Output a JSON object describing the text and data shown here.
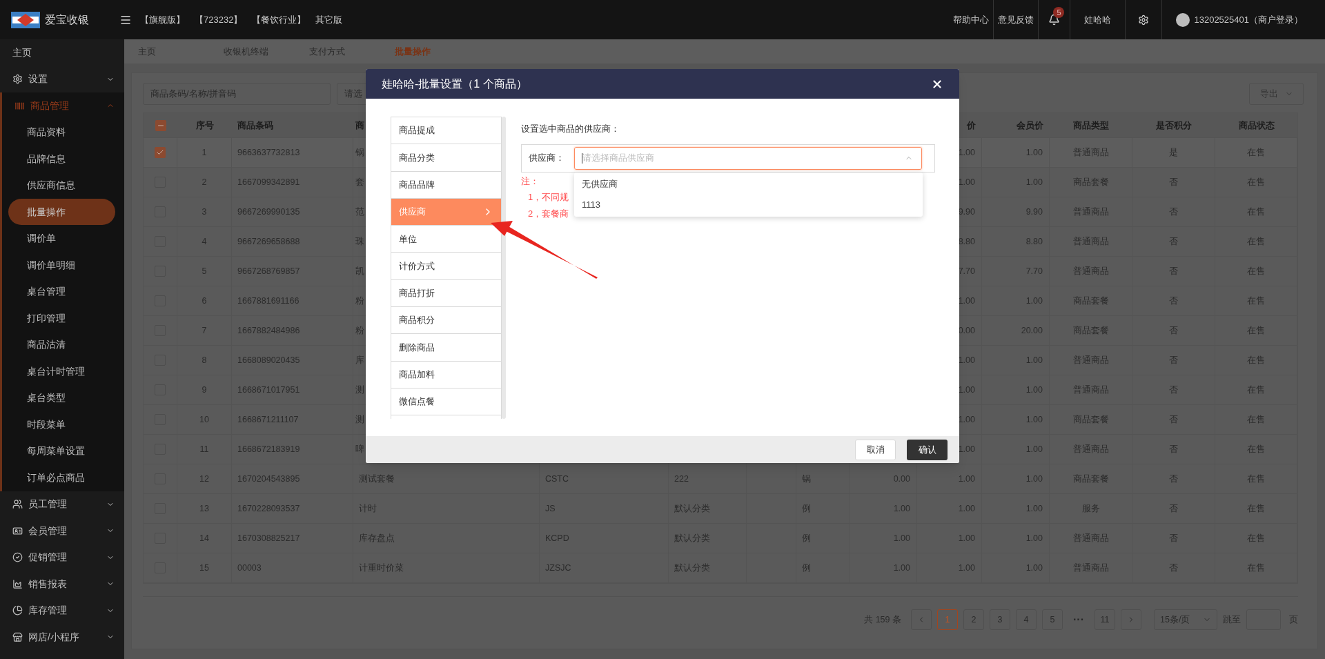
{
  "top_bar": {
    "brand": "爱宝收银",
    "editions": [
      "【旗舰版】",
      "【723232】",
      "【餐饮行业】",
      "其它版"
    ],
    "links": [
      "帮助中心",
      "意见反馈"
    ],
    "notification_count": "5",
    "user": "娃哈哈",
    "account": "13202525401（商户登录）"
  },
  "sidebar": {
    "items": [
      {
        "label": "主页",
        "selected": false
      },
      {
        "label": "设置",
        "selected": false,
        "expanded": false
      },
      {
        "label": "商品管理",
        "selected": false,
        "expanded": true,
        "children": [
          {
            "label": "商品资料",
            "selected": false
          },
          {
            "label": "品牌信息",
            "selected": false
          },
          {
            "label": "供应商信息",
            "selected": false
          },
          {
            "label": "批量操作",
            "selected": true
          },
          {
            "label": "调价单",
            "selected": false
          },
          {
            "label": "调价单明细",
            "selected": false
          },
          {
            "label": "桌台管理",
            "selected": false
          },
          {
            "label": "打印管理",
            "selected": false
          },
          {
            "label": "商品沽清",
            "selected": false
          },
          {
            "label": "桌台计时管理",
            "selected": false
          },
          {
            "label": "桌台类型",
            "selected": false
          },
          {
            "label": "时段菜单",
            "selected": false
          },
          {
            "label": "每周菜单设置",
            "selected": false
          },
          {
            "label": "订单必点商品",
            "selected": false
          }
        ]
      },
      {
        "label": "员工管理",
        "selected": false,
        "expanded": false
      },
      {
        "label": "会员管理",
        "selected": false,
        "expanded": false
      },
      {
        "label": "促销管理",
        "selected": false,
        "expanded": false
      },
      {
        "label": "销售报表",
        "selected": false,
        "expanded": false
      },
      {
        "label": "库存管理",
        "selected": false,
        "expanded": false
      },
      {
        "label": "网店/小程序",
        "selected": false,
        "expanded": false
      }
    ]
  },
  "tabs": [
    {
      "label": "主页",
      "selected": false
    },
    {
      "label": "收银机终端",
      "selected": false
    },
    {
      "label": "支付方式",
      "selected": false
    },
    {
      "label": "批量操作",
      "selected": true
    }
  ],
  "filters": {
    "search": {
      "placeholder": "商品条码/名称/拼音码"
    },
    "select": {
      "placeholder": "请选"
    },
    "export_button": "导出"
  },
  "table": {
    "select_all": {
      "indeterminate": true
    },
    "header": {
      "no": "序号",
      "barcode": "商品条码",
      "column_4": "商",
      "column_10": "价",
      "member_price": "会员价",
      "type": "商品类型",
      "points": "是否积分",
      "status": "商品状态"
    },
    "rows": [
      {
        "selected": true,
        "no": "1",
        "barcode": "9663637732813",
        "column_4": "锅",
        "column_10": "1.00",
        "member_price": "1.00",
        "type": "普通商品",
        "points": "是",
        "status": "在售"
      },
      {
        "selected": false,
        "no": "2",
        "barcode": "1667099342891",
        "column_4": "套",
        "column_10": "1.00",
        "member_price": "1.00",
        "type": "商品套餐",
        "points": "否",
        "status": "在售"
      },
      {
        "selected": false,
        "no": "3",
        "barcode": "9667269990135",
        "column_4": "范",
        "column_10": "9.90",
        "member_price": "9.90",
        "type": "普通商品",
        "points": "否",
        "status": "在售"
      },
      {
        "selected": false,
        "no": "4",
        "barcode": "9667269658688",
        "column_4": "珠",
        "column_10": "8.80",
        "member_price": "8.80",
        "type": "普通商品",
        "points": "否",
        "status": "在售"
      },
      {
        "selected": false,
        "no": "5",
        "barcode": "9667268769857",
        "column_4": "凯",
        "column_10": "7.70",
        "member_price": "7.70",
        "type": "普通商品",
        "points": "否",
        "status": "在售"
      },
      {
        "selected": false,
        "no": "6",
        "barcode": "1667881691166",
        "column_4": "粉",
        "column_10": "1.00",
        "member_price": "1.00",
        "type": "商品套餐",
        "points": "否",
        "status": "在售"
      },
      {
        "selected": false,
        "no": "7",
        "barcode": "1667882484986",
        "column_4": "粉",
        "column_10": "0.00",
        "member_price": "20.00",
        "type": "商品套餐",
        "points": "否",
        "status": "在售"
      },
      {
        "selected": false,
        "no": "8",
        "barcode": "1668089020435",
        "column_4": "库",
        "column_10": "1.00",
        "member_price": "1.00",
        "type": "普通商品",
        "points": "否",
        "status": "在售"
      },
      {
        "selected": false,
        "no": "9",
        "barcode": "1668671017951",
        "column_4": "测",
        "column_10": "1.00",
        "member_price": "1.00",
        "type": "普通商品",
        "points": "否",
        "status": "在售"
      },
      {
        "selected": false,
        "no": "10",
        "barcode": "1668671211107",
        "column_4": "测",
        "column_10": "1.00",
        "member_price": "1.00",
        "type": "商品套餐",
        "points": "否",
        "status": "在售"
      },
      {
        "selected": false,
        "no": "11",
        "barcode": "1668672183919",
        "column_4": "啤",
        "column_10": "1.00",
        "member_price": "1.00",
        "type": "普通商品",
        "points": "否",
        "status": "在售"
      },
      {
        "selected": false,
        "no": "12",
        "barcode": "1670204543895",
        "column_4": "测试套餐",
        "column_5": "CSTC",
        "column_6": "222",
        "column_8": "锅",
        "column_9": "0.00",
        "column_10": "1.00",
        "member_price": "1.00",
        "type": "商品套餐",
        "points": "否",
        "status": "在售"
      },
      {
        "selected": false,
        "no": "13",
        "barcode": "1670228093537",
        "column_4": "计时",
        "column_5": "JS",
        "column_6": "默认分类",
        "column_8": "例",
        "column_9": "1.00",
        "column_10": "1.00",
        "member_price": "1.00",
        "type": "服务",
        "points": "否",
        "status": "在售"
      },
      {
        "selected": false,
        "no": "14",
        "barcode": "1670308825217",
        "column_4": "库存盘点",
        "column_5": "KCPD",
        "column_6": "默认分类",
        "column_8": "例",
        "column_9": "1.00",
        "column_10": "1.00",
        "member_price": "1.00",
        "type": "普通商品",
        "points": "否",
        "status": "在售"
      },
      {
        "selected": false,
        "no": "15",
        "barcode": "00003",
        "column_4": "计重时价菜",
        "column_5": "JZSJC",
        "column_6": "默认分类",
        "column_8": "例",
        "column_9": "1.00",
        "column_10": "1.00",
        "member_price": "1.00",
        "type": "普通商品",
        "points": "否",
        "status": "在售"
      }
    ]
  },
  "pagination": {
    "total": "共 159 条",
    "pages": [
      {
        "kind": "page",
        "label": "1",
        "selected": true
      },
      {
        "kind": "page",
        "label": "2",
        "selected": false
      },
      {
        "kind": "page",
        "label": "3",
        "selected": false
      },
      {
        "kind": "page",
        "label": "4",
        "selected": false
      },
      {
        "kind": "page",
        "label": "5",
        "selected": false
      },
      {
        "kind": "ellipsis",
        "label": "···"
      },
      {
        "kind": "page",
        "label": "11",
        "selected": false
      }
    ],
    "page_size": "15条/页",
    "jump_label": "跳至",
    "page_suffix": "页"
  },
  "dialog": {
    "title": "娃哈哈-批量设置（1 个商品）",
    "menu": [
      {
        "label": "商品提成",
        "selected": false
      },
      {
        "label": "商品分类",
        "selected": false
      },
      {
        "label": "商品品牌",
        "selected": false
      },
      {
        "label": "供应商",
        "selected": true
      },
      {
        "label": "单位",
        "selected": false
      },
      {
        "label": "计价方式",
        "selected": false
      },
      {
        "label": "商品打折",
        "selected": false
      },
      {
        "label": "商品积分",
        "selected": false
      },
      {
        "label": "删除商品",
        "selected": false
      },
      {
        "label": "商品加料",
        "selected": false
      },
      {
        "label": "微信点餐",
        "selected": false
      }
    ],
    "heading": "设置选中商品的供应商：",
    "field": {
      "label": "供应商：",
      "placeholder": "请选择商品供应商",
      "open": true,
      "options": [
        {
          "label": "无供应商",
          "selected": false
        },
        {
          "label": "1113",
          "selected": false
        }
      ]
    },
    "note": {
      "title": "注：",
      "lines": [
        "1，不同规",
        "2，套餐商"
      ]
    },
    "buttons": [
      "取消",
      "确认"
    ]
  }
}
